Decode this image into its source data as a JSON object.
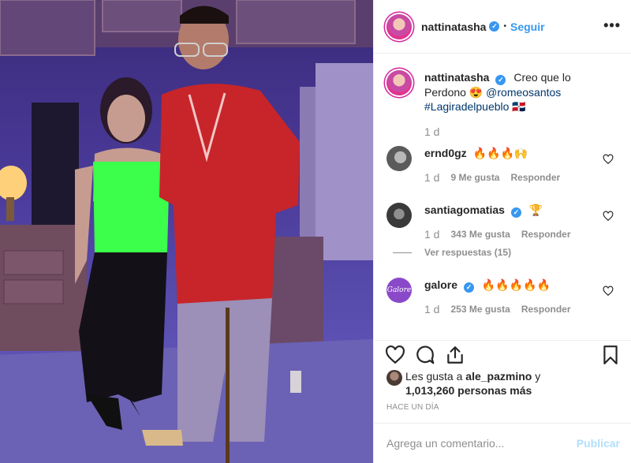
{
  "header": {
    "username": "nattinatasha",
    "separator": "•",
    "follow_label": "Seguir",
    "more_icon": "more-horizontal-icon"
  },
  "caption": {
    "username": "nattinatasha",
    "text": "Creo que lo Perdono 😍",
    "mention": "@romeosantos",
    "hashtag": "#Lagiradelpueblo",
    "flag": "🇩🇴",
    "age": "1 d"
  },
  "comments": [
    {
      "username": "ernd0gz",
      "verified": false,
      "text": "🔥🔥🔥🙌",
      "age": "1 d",
      "likes": "9 Me gusta",
      "reply": "Responder"
    },
    {
      "username": "santiagomatias",
      "verified": true,
      "text": "🏆",
      "age": "1 d",
      "likes": "343 Me gusta",
      "reply": "Responder",
      "view_replies": "Ver respuestas (15)"
    },
    {
      "username": "galore",
      "verified": true,
      "avatar_text": "Galore",
      "text": "🔥🔥🔥🔥🔥",
      "age": "1 d",
      "likes": "253 Me gusta",
      "reply": "Responder"
    }
  ],
  "likes": {
    "prefix": "Les gusta a ",
    "user": "ale_pazmino",
    "conjunction": " y",
    "others": "1,013,260 personas más"
  },
  "time_ago": "HACE UN DÍA",
  "composer": {
    "placeholder": "Agrega un comentario...",
    "publish_label": "Publicar"
  },
  "icons": {
    "like": "heart-icon",
    "comment": "comment-icon",
    "share": "share-icon",
    "save": "bookmark-icon"
  },
  "colors": {
    "accent": "#3897f0",
    "publish_disabled": "#b2dffc",
    "muted": "#8e8e8e"
  }
}
